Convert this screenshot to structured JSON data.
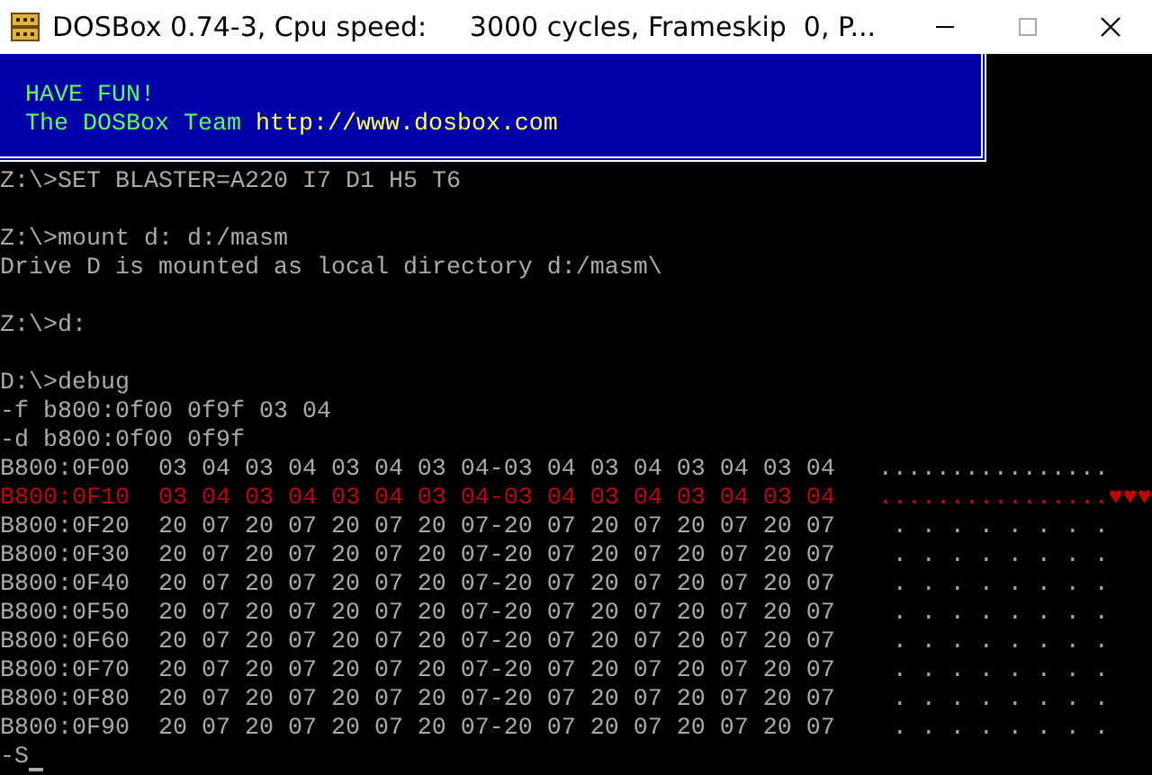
{
  "window": {
    "title": "DOSBox 0.74-3, Cpu speed:     3000 cycles, Frameskip  0, P..."
  },
  "banner": {
    "lines": [
      {
        "parts": [
          {
            "text": "HAVE FUN!",
            "kind": "green"
          }
        ]
      },
      {
        "parts": [
          {
            "text": "The DOSBox Team",
            "kind": "green"
          },
          {
            "text": "http://www.dosbox.com",
            "kind": "yellow"
          }
        ]
      }
    ]
  },
  "terminal": {
    "lines": [
      {
        "kind": "text",
        "text": "Z:\\>SET BLASTER=A220 I7 D1 H5 T6"
      },
      {
        "kind": "blank"
      },
      {
        "kind": "text",
        "text": "Z:\\>mount d: d:/masm"
      },
      {
        "kind": "text",
        "text": "Drive D is mounted as local directory d:/masm\\"
      },
      {
        "kind": "blank"
      },
      {
        "kind": "text",
        "text": "Z:\\>d:"
      },
      {
        "kind": "blank"
      },
      {
        "kind": "text",
        "text": "D:\\>debug"
      },
      {
        "kind": "text",
        "text": "-f b800:0f00 0f9f 03 04"
      },
      {
        "kind": "text",
        "text": "-d b800:0f00 0f9f"
      },
      {
        "kind": "dump",
        "address": "B800:0F00",
        "bytes": "03 04 03 04 03 04 03 04-03 04 03 04 03 04 03 04",
        "ascii": "................",
        "color": "#aaaaaa"
      },
      {
        "kind": "dump",
        "address": "B800:0F10",
        "bytes": "03 04 03 04 03 04 03 04-03 04 03 04 03 04 03 04",
        "ascii": "................♥♥♥",
        "color": "#c40000"
      },
      {
        "kind": "dump",
        "address": "B800:0F20",
        "bytes": "20 07 20 07 20 07 20 07-20 07 20 07 20 07 20 07",
        "ascii": " . . . . . . . .",
        "color": "#aaaaaa"
      },
      {
        "kind": "dump",
        "address": "B800:0F30",
        "bytes": "20 07 20 07 20 07 20 07-20 07 20 07 20 07 20 07",
        "ascii": " . . . . . . . .",
        "color": "#aaaaaa"
      },
      {
        "kind": "dump",
        "address": "B800:0F40",
        "bytes": "20 07 20 07 20 07 20 07-20 07 20 07 20 07 20 07",
        "ascii": " . . . . . . . .",
        "color": "#aaaaaa"
      },
      {
        "kind": "dump",
        "address": "B800:0F50",
        "bytes": "20 07 20 07 20 07 20 07-20 07 20 07 20 07 20 07",
        "ascii": " . . . . . . . .",
        "color": "#aaaaaa"
      },
      {
        "kind": "dump",
        "address": "B800:0F60",
        "bytes": "20 07 20 07 20 07 20 07-20 07 20 07 20 07 20 07",
        "ascii": " . . . . . . . .",
        "color": "#aaaaaa"
      },
      {
        "kind": "dump",
        "address": "B800:0F70",
        "bytes": "20 07 20 07 20 07 20 07-20 07 20 07 20 07 20 07",
        "ascii": " . . . . . . . .",
        "color": "#aaaaaa"
      },
      {
        "kind": "dump",
        "address": "B800:0F80",
        "bytes": "20 07 20 07 20 07 20 07-20 07 20 07 20 07 20 07",
        "ascii": " . . . . . . . .",
        "color": "#aaaaaa"
      },
      {
        "kind": "dump",
        "address": "B800:0F90",
        "bytes": "20 07 20 07 20 07 20 07-20 07 20 07 20 07 20 07",
        "ascii": " . . . . . . . .",
        "color": "#aaaaaa"
      },
      {
        "kind": "input",
        "text": "-S"
      }
    ]
  }
}
